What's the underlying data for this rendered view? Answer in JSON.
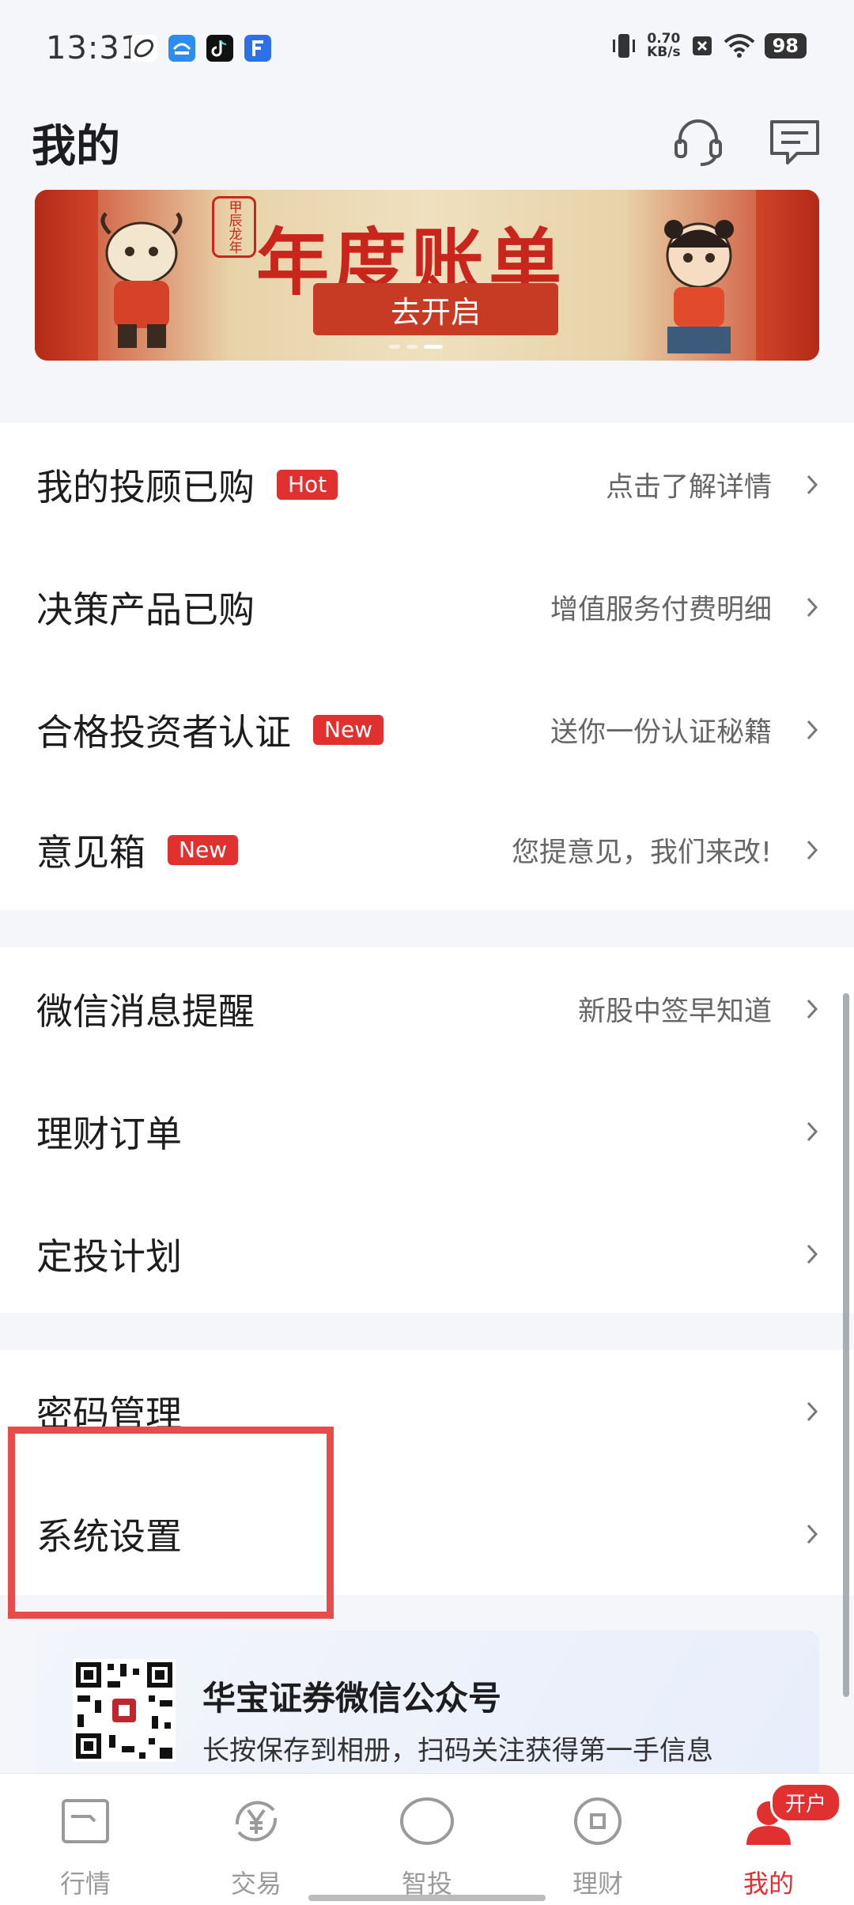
{
  "status_bar": {
    "time": "13:31",
    "net_speed_value": "0.70",
    "net_speed_unit": "KB/s",
    "battery": "98"
  },
  "header": {
    "title": "我的",
    "icons": [
      "headset-icon",
      "message-icon"
    ]
  },
  "banner": {
    "title": "年度账单",
    "button": "去开启",
    "seal": "甲辰龙年"
  },
  "group1": [
    {
      "label": "我的投顾已购",
      "badge": "Hot",
      "hint": "点击了解详情"
    },
    {
      "label": "决策产品已购",
      "badge": "",
      "hint": "增值服务付费明细"
    },
    {
      "label": "合格投资者认证",
      "badge": "New",
      "hint": "送你一份认证秘籍"
    },
    {
      "label": "意见箱",
      "badge": "New",
      "hint": "您提意见，我们来改!"
    }
  ],
  "group2": [
    {
      "label": "微信消息提醒",
      "hint": "新股中签早知道"
    },
    {
      "label": "理财订单",
      "hint": ""
    },
    {
      "label": "定投计划",
      "hint": ""
    }
  ],
  "group3": [
    {
      "label": "密码管理"
    },
    {
      "label": "系统设置"
    }
  ],
  "wechat_card": {
    "title": "华宝证券微信公众号",
    "desc": "长按保存到相册，扫码关注获得第一手信息"
  },
  "tabbar": {
    "tabs": [
      {
        "label": "行情",
        "icon": "market-icon"
      },
      {
        "label": "交易",
        "icon": "yuan-icon"
      },
      {
        "label": "智投",
        "icon": "smart-invest-icon"
      },
      {
        "label": "理财",
        "icon": "wealth-icon"
      },
      {
        "label": "我的",
        "icon": "profile-icon"
      }
    ],
    "open_account_badge": "开户",
    "active_tab": "我的"
  },
  "colors": {
    "accent": "#e03030",
    "highlight": "#e84b4b"
  }
}
